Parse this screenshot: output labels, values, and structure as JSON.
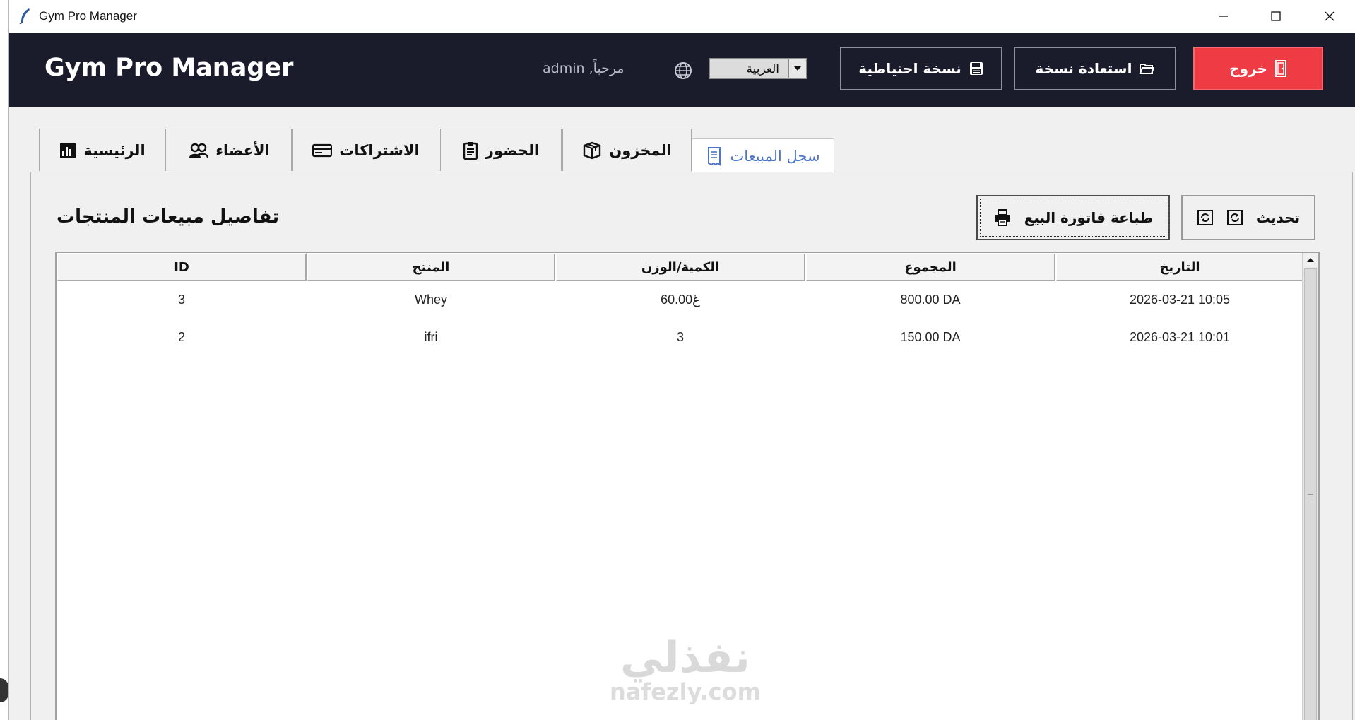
{
  "window": {
    "title": "Gym Pro Manager"
  },
  "header": {
    "brand": "Gym Pro Manager",
    "welcome": "مرحباً, admin",
    "language": {
      "selected": "العربية"
    },
    "buttons": {
      "backup": "نسخة احتياطية",
      "restore": "استعادة نسخة",
      "logout": "خروج"
    }
  },
  "tabs": [
    {
      "label": "الرئيسية",
      "icon": "bar-chart-icon"
    },
    {
      "label": "الأعضاء",
      "icon": "users-icon"
    },
    {
      "label": "الاشتراكات",
      "icon": "card-icon"
    },
    {
      "label": "الحضور",
      "icon": "clipboard-icon"
    },
    {
      "label": "المخزون",
      "icon": "box-icon"
    },
    {
      "label": "سجل المبيعات",
      "icon": "receipt-icon",
      "active": true
    }
  ],
  "sales": {
    "title": "تفاصيل مبيعات المنتجات",
    "print_label": "طباعة فاتورة البيع",
    "refresh_label": "تحديث",
    "columns": {
      "id": "ID",
      "product": "المنتج",
      "qty": "الكمية/الوزن",
      "total": "المجموع",
      "date": "التاريخ"
    },
    "rows": [
      {
        "id": "3",
        "product": "Whey",
        "qty": "60.00غ",
        "total": "800.00 DA",
        "date": "2026-03-21 10:05"
      },
      {
        "id": "2",
        "product": "ifri",
        "qty": "3",
        "total": "150.00 DA",
        "date": "2026-03-21 10:01"
      }
    ]
  },
  "watermark": {
    "arabic": "نفذلي",
    "latin": "nafezly.com"
  },
  "colors": {
    "header_bg": "#1a1c2c",
    "logout_bg": "#ef3b43",
    "active_tab_text": "#4d74c9"
  }
}
